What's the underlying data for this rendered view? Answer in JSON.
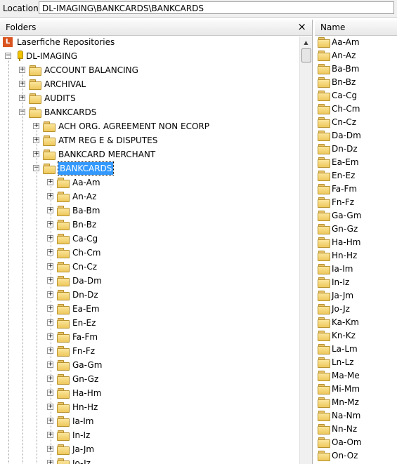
{
  "location": {
    "label": "Location:",
    "path": "DL-IMAGING\\BANKCARDS\\BANKCARDS"
  },
  "folders_pane": {
    "title": "Folders",
    "close": "×"
  },
  "tree": {
    "root": "Laserfiche Repositories",
    "repository": "DL-IMAGING",
    "level1": [
      "ACCOUNT BALANCING",
      "ARCHIVAL",
      "AUDITS",
      "BANKCARDS"
    ],
    "level2": [
      "ACH ORG. AGREEMENT NON ECORP",
      "ATM REG E & DISPUTES",
      "BANKCARD MERCHANT",
      "BANKCARDS"
    ],
    "level3": [
      "Aa-Am",
      "An-Az",
      "Ba-Bm",
      "Bn-Bz",
      "Ca-Cg",
      "Ch-Cm",
      "Cn-Cz",
      "Da-Dm",
      "Dn-Dz",
      "Ea-Em",
      "En-Ez",
      "Fa-Fm",
      "Fn-Fz",
      "Ga-Gm",
      "Gn-Gz",
      "Ha-Hm",
      "Hn-Hz",
      "Ia-Im",
      "In-Iz",
      "Ja-Jm",
      "Jo-Jz"
    ]
  },
  "name_pane": {
    "title": "Name",
    "items": [
      "Aa-Am",
      "An-Az",
      "Ba-Bm",
      "Bn-Bz",
      "Ca-Cg",
      "Ch-Cm",
      "Cn-Cz",
      "Da-Dm",
      "Dn-Dz",
      "Ea-Em",
      "En-Ez",
      "Fa-Fm",
      "Fn-Fz",
      "Ga-Gm",
      "Gn-Gz",
      "Ha-Hm",
      "Hn-Hz",
      "Ia-Im",
      "In-Iz",
      "Ja-Jm",
      "Jo-Jz",
      "Ka-Km",
      "Kn-Kz",
      "La-Lm",
      "Ln-Lz",
      "Ma-Me",
      "Mi-Mm",
      "Mn-Mz",
      "Na-Nm",
      "Nn-Nz",
      "Oa-Om",
      "On-Oz"
    ]
  },
  "colors": {
    "selection": "#3399ff",
    "folder": "#eec85c",
    "repo_icon": "#d9541e"
  }
}
